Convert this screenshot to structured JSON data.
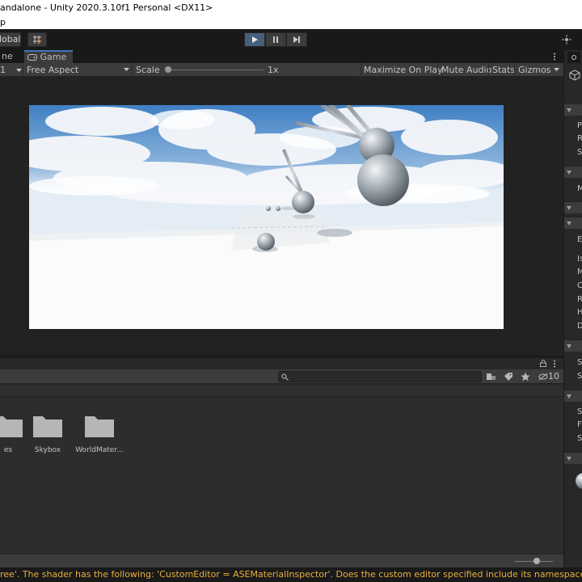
{
  "window": {
    "title": "andalone - Unity 2020.3.10f1 Personal <DX11>"
  },
  "menubar": {
    "visible_item": "p"
  },
  "toolbar": {
    "global_label": "lobal"
  },
  "tabs": [
    {
      "label": "ne"
    },
    {
      "label": "Game"
    }
  ],
  "game_toolbar": {
    "display_label": "1",
    "aspect_label": "Free Aspect",
    "scale_label": "Scale",
    "scale_value": "1x",
    "scale_fraction": 0.0,
    "maximize_label": "Maximize On Play",
    "mute_label": "Mute Audio",
    "stats_label": "Stats",
    "gizmos_label": "Gizmos"
  },
  "project": {
    "hidden_count": "10",
    "search_placeholder": "",
    "folders": [
      {
        "label": "es"
      },
      {
        "label": "Skybox"
      },
      {
        "label": "WorldMater..."
      }
    ],
    "zoom_fraction": 0.6
  },
  "right_panel": {
    "letters": [
      "P",
      "R",
      "S",
      "M",
      "E",
      "Is",
      "M",
      "C",
      "R",
      "H",
      "D",
      "S",
      "S",
      "S",
      "F",
      "S"
    ]
  },
  "status": {
    "message": "ree'. The shader has the following: 'CustomEditor = ASEMaterialInspector'. Does the custom editor specified include its namespace? And does the class"
  },
  "colors": {
    "accent": "#3a79bb",
    "warning_text": "#e8b040",
    "play_active": "#46607c"
  }
}
